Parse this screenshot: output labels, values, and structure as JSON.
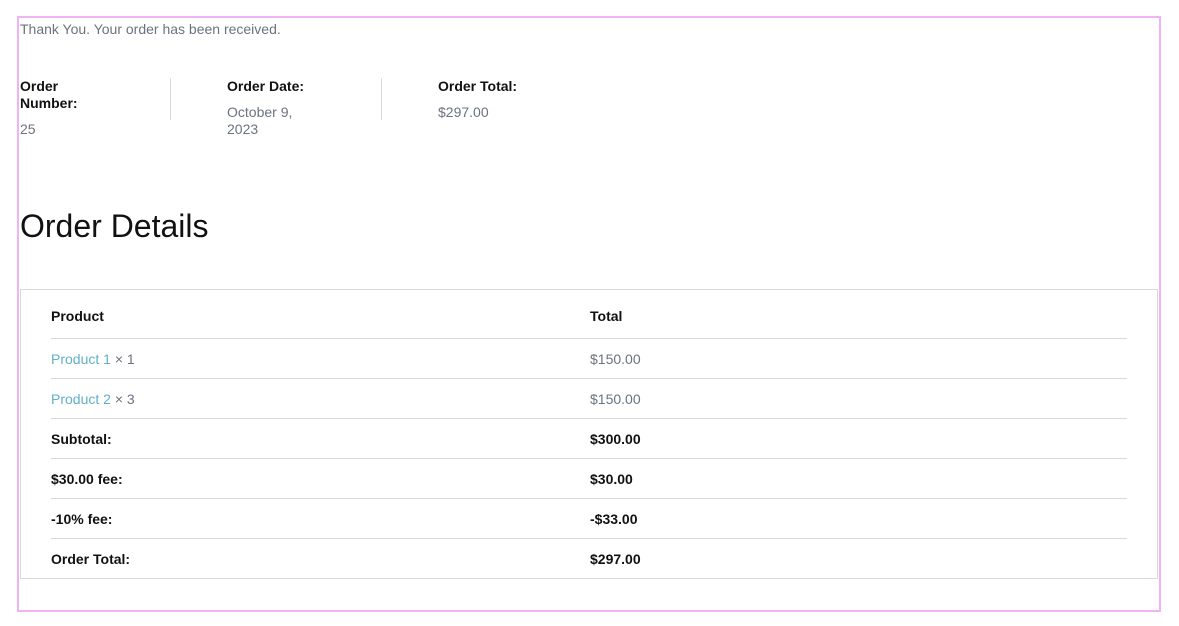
{
  "message": "Thank You. Your order has been received.",
  "overview": {
    "order_number_label": "Order Number:",
    "order_number_value": "25",
    "order_date_label": "Order Date:",
    "order_date_value": "October 9, 2023",
    "order_total_label": "Order Total:",
    "order_total_value": "$297.00"
  },
  "details": {
    "title": "Order Details",
    "headers": {
      "product": "Product",
      "total": "Total"
    },
    "items": [
      {
        "name": "Product 1",
        "qty": " × 1",
        "total": "$150.00"
      },
      {
        "name": "Product 2",
        "qty": " × 3",
        "total": "$150.00"
      }
    ],
    "totals": [
      {
        "label": "Subtotal:",
        "value": "$300.00"
      },
      {
        "label": "$30.00 fee:",
        "value": "$30.00"
      },
      {
        "label": "-10% fee:",
        "value": "-$33.00"
      },
      {
        "label": "Order Total:",
        "value": "$297.00"
      }
    ]
  },
  "colors": {
    "link": "#5fb0c9",
    "muted_text": "#6b7280",
    "frame_outline": "#f0b3f5",
    "border": "#d9d9d9"
  }
}
